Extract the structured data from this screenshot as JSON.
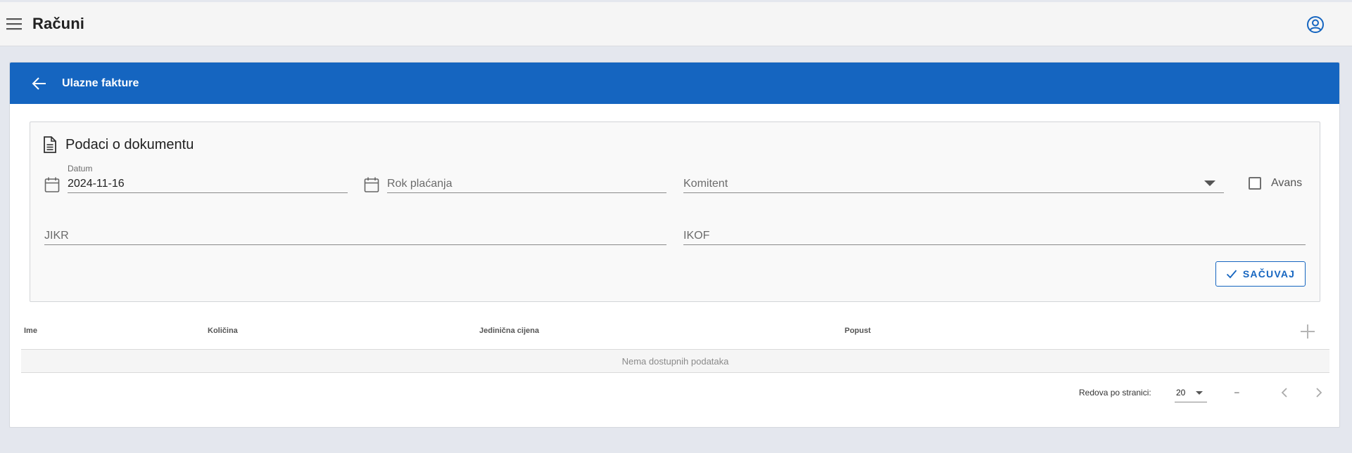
{
  "appbar": {
    "title": "Računi"
  },
  "card": {
    "header_title": "Ulazne fakture"
  },
  "document": {
    "section_title": "Podaci o dokumentu",
    "datum": {
      "label": "Datum",
      "value": "2024-11-16"
    },
    "rok_placanja": {
      "placeholder": "Rok plaćanja"
    },
    "komitent": {
      "placeholder": "Komitent"
    },
    "avans": {
      "label": "Avans",
      "checked": false
    },
    "jikr": {
      "placeholder": "JIKR"
    },
    "ikof": {
      "placeholder": "IKOF"
    },
    "save_label": "SAČUVAJ"
  },
  "table": {
    "columns": [
      "Ime",
      "Količina",
      "Jedinična cijena",
      "Popust"
    ],
    "empty_text": "Nema dostupnih podataka"
  },
  "pagination": {
    "rows_per_page_label": "Redova po stranici:",
    "rows_per_page": "20",
    "range": "–"
  },
  "colors": {
    "primary": "#1565c0",
    "background": "#e4e7ee",
    "appbar": "#f5f5f5"
  },
  "icons": {
    "menu": "menu-icon",
    "account": "account-circle-icon",
    "back": "arrow-left-icon",
    "document": "document-icon",
    "calendar": "calendar-icon",
    "check": "check-icon",
    "add": "plus-icon",
    "prev": "chevron-left-icon",
    "next": "chevron-right-icon"
  }
}
